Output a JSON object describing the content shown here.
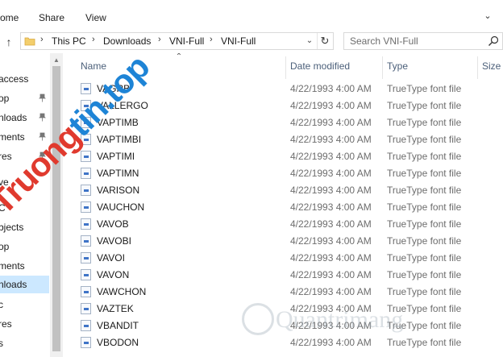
{
  "ribbon": {
    "tabs": [
      "ome",
      "Share",
      "View"
    ]
  },
  "address": {
    "breadcrumb": [
      "This PC",
      "Downloads",
      "VNI-Full",
      "VNI-Full"
    ]
  },
  "search": {
    "placeholder": "Search VNI-Full"
  },
  "nav": {
    "items": [
      {
        "label": "access",
        "pinned": false
      },
      {
        "label": "op",
        "pinned": true
      },
      {
        "label": "nloads",
        "pinned": true
      },
      {
        "label": "ments",
        "pinned": true
      },
      {
        "label": "res",
        "pinned": true
      },
      {
        "label": "ve",
        "pinned": false
      },
      {
        "label": "C",
        "pinned": false
      },
      {
        "label": "bjects",
        "pinned": false
      },
      {
        "label": "op",
        "pinned": false
      },
      {
        "label": "ments",
        "pinned": false
      },
      {
        "label": "nloads",
        "pinned": false,
        "selected": true
      },
      {
        "label": "c",
        "pinned": false
      },
      {
        "label": "res",
        "pinned": false
      },
      {
        "label": "s",
        "pinned": false
      }
    ]
  },
  "columns": {
    "name": "Name",
    "date_modified": "Date modified",
    "type": "Type",
    "size": "Size"
  },
  "files": [
    {
      "name": "VAGRB",
      "date": "4/22/1993 4:00 AM",
      "type": "TrueType font file"
    },
    {
      "name": "VALLERGO",
      "date": "4/22/1993 4:00 AM",
      "type": "TrueType font file"
    },
    {
      "name": "VAPTIMB",
      "date": "4/22/1993 4:00 AM",
      "type": "TrueType font file"
    },
    {
      "name": "VAPTIMBI",
      "date": "4/22/1993 4:00 AM",
      "type": "TrueType font file"
    },
    {
      "name": "VAPTIMI",
      "date": "4/22/1993 4:00 AM",
      "type": "TrueType font file"
    },
    {
      "name": "VAPTIMN",
      "date": "4/22/1993 4:00 AM",
      "type": "TrueType font file"
    },
    {
      "name": "VARISON",
      "date": "4/22/1993 4:00 AM",
      "type": "TrueType font file"
    },
    {
      "name": "VAUCHON",
      "date": "4/22/1993 4:00 AM",
      "type": "TrueType font file"
    },
    {
      "name": "VAVOB",
      "date": "4/22/1993 4:00 AM",
      "type": "TrueType font file"
    },
    {
      "name": "VAVOBI",
      "date": "4/22/1993 4:00 AM",
      "type": "TrueType font file"
    },
    {
      "name": "VAVOI",
      "date": "4/22/1993 4:00 AM",
      "type": "TrueType font file"
    },
    {
      "name": "VAVON",
      "date": "4/22/1993 4:00 AM",
      "type": "TrueType font file"
    },
    {
      "name": "VAWCHON",
      "date": "4/22/1993 4:00 AM",
      "type": "TrueType font file"
    },
    {
      "name": "VAZTEK",
      "date": "4/22/1993 4:00 AM",
      "type": "TrueType font file"
    },
    {
      "name": "VBANDIT",
      "date": "4/22/1993 4:00 AM",
      "type": "TrueType font file"
    },
    {
      "name": "VBODON",
      "date": "4/22/1993 4:00 AM",
      "type": "TrueType font file"
    }
  ],
  "watermark": {
    "main_part1": "Truong",
    "main_part2": "tin.top",
    "bottom": "Quantrimang"
  },
  "colors": {
    "selected_bg": "#cce8ff",
    "header_text": "#4c607a",
    "watermark_red": "#e03a2e",
    "watermark_blue": "#1e84d6"
  }
}
